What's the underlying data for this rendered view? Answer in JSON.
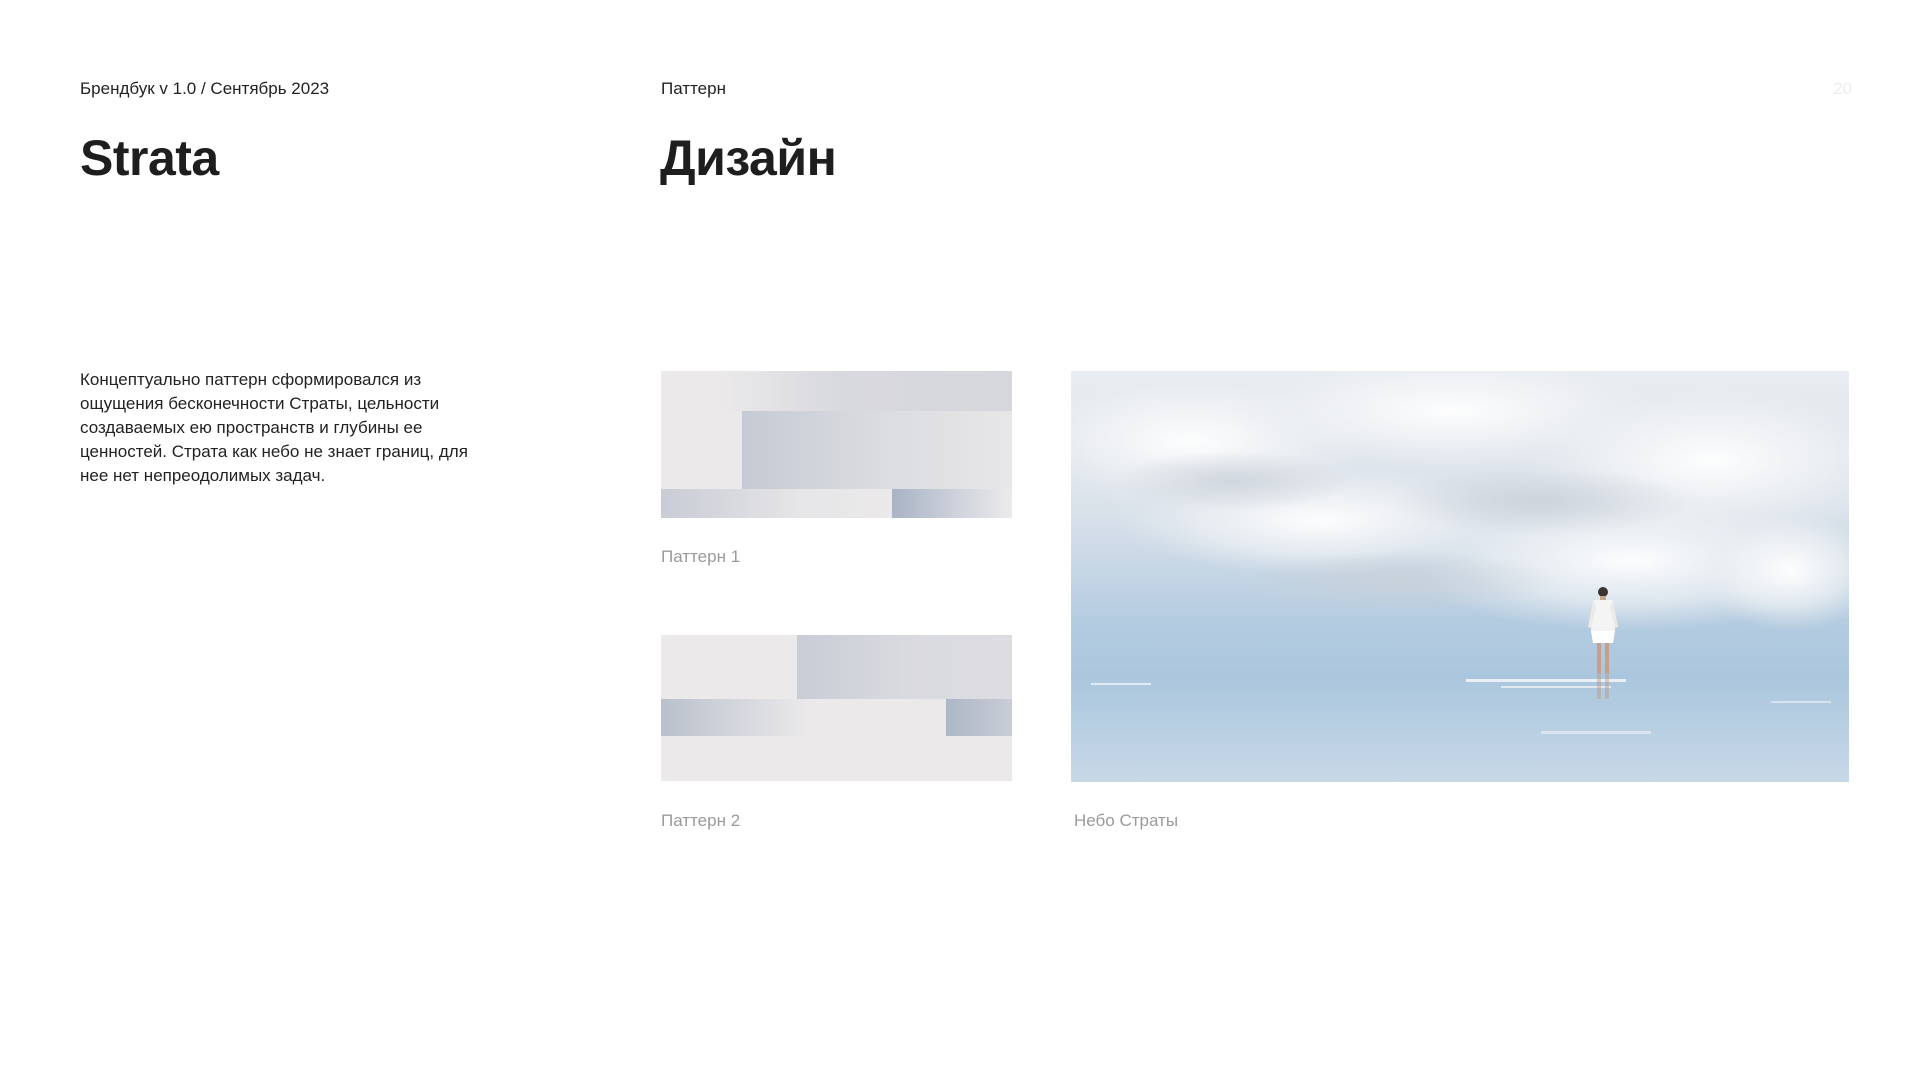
{
  "header": {
    "brandbook_label": "Брендбук v 1.0 / Сентябрь 2023",
    "section_label": "Паттерн",
    "page_number": "20"
  },
  "titles": {
    "brand": "Strata",
    "section": "Дизайн"
  },
  "description": "Концептуально паттерн сформировался из ощущения бесконечности Страты, цельности создаваемых ею пространств и глубины ее ценностей. Страта как небо не знает границ, для нее нет непреодолимых задач.",
  "figures": {
    "pattern_1_caption": "Паттерн 1",
    "pattern_2_caption": "Паттерн 2",
    "sky_caption": "Небо Страты"
  },
  "colors": {
    "pattern_base": "#ebe9ea",
    "pattern_accent": "#a9b4c6",
    "sky_top": "#eceff3",
    "sky_horizon": "#a9c6df"
  }
}
